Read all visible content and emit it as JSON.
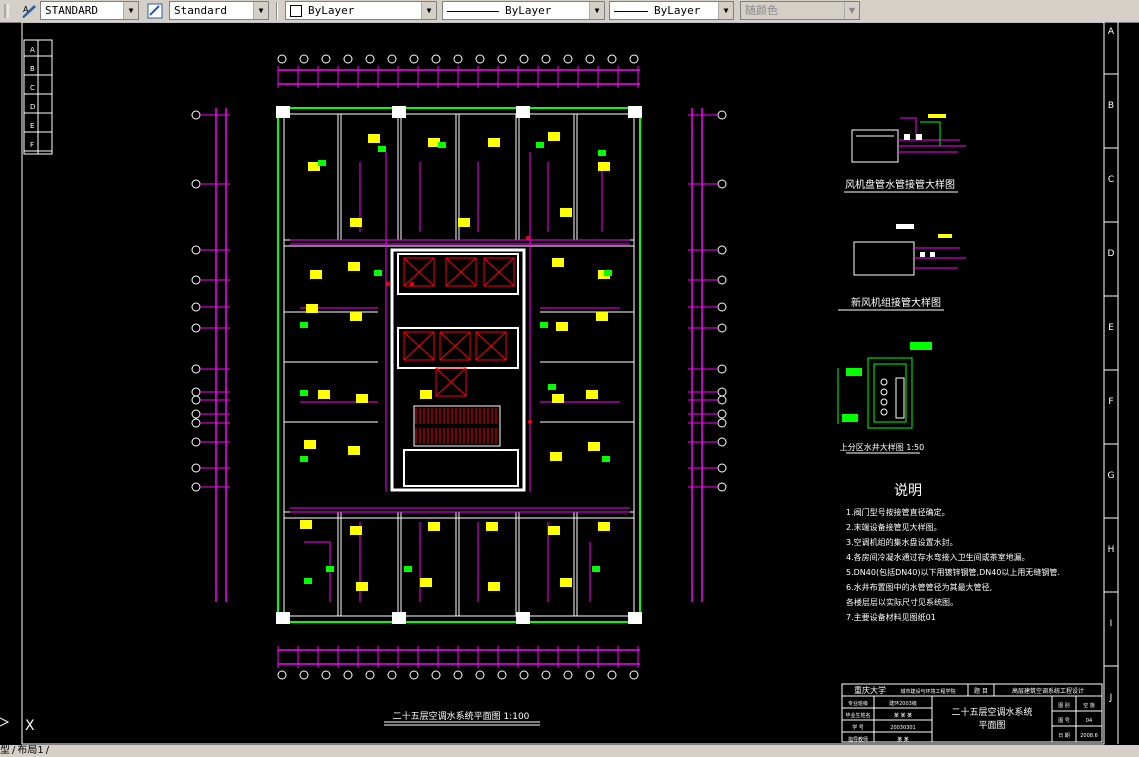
{
  "toolbar": {
    "text_style": "STANDARD",
    "dim_style": "Standard",
    "layer_color": "ByLayer",
    "linetype": "ByLayer",
    "lineweight": "ByLayer",
    "plot_style": "随颜色"
  },
  "drawing": {
    "plan_title": "二十五层空调水系统平面图 1:100",
    "detail1_title": "风机盘管水管接管大样图",
    "detail2_title": "新风机组接管大样图",
    "detail3_title": "上分区水井大样图 1:50",
    "notes_title": "说明",
    "notes": [
      "1.阀门型号按接管直径确定。",
      "2.末端设备接管见大样图。",
      "3.空调机组的集水盘设置水封。",
      "4.各房间冷凝水通过存水弯接入卫生间或茶室地漏。",
      "5.DN40(包括DN40)以下用镀锌钢管,DN40以上用无缝钢管.",
      "6.水井布置图中的水管管径为其最大管径,",
      "  各楼层层以实际尺寸见系统图。",
      "7.主要设备材料见图纸01"
    ],
    "title_block": {
      "school": "重庆大学",
      "dept": "城市建设与环境工程学院",
      "project_label": "题 目",
      "project": "高层建筑空调系统工程设计",
      "drawing_name_line1": "二十五层空调水系统",
      "drawing_name_line2": "平面图",
      "row_labels": [
        "专业班级",
        "毕业生姓名",
        "学 号",
        "指导教师"
      ],
      "row_values": [
        "建环2003级",
        "某 某 某",
        "20030301",
        "某 某"
      ],
      "field_labels": [
        "图 别",
        "图 号",
        "日 期"
      ],
      "field_values": [
        "空 施",
        "04",
        "2008.6"
      ]
    },
    "grid_letters": [
      "A",
      "B",
      "C",
      "D",
      "E",
      "F",
      "G",
      "H",
      "I",
      "J"
    ],
    "left_marks": [
      "A",
      "B",
      "C",
      "D",
      "E",
      "F"
    ],
    "coord_marker": "X"
  },
  "tabs": {
    "model": "型",
    "layout": "布局1"
  }
}
